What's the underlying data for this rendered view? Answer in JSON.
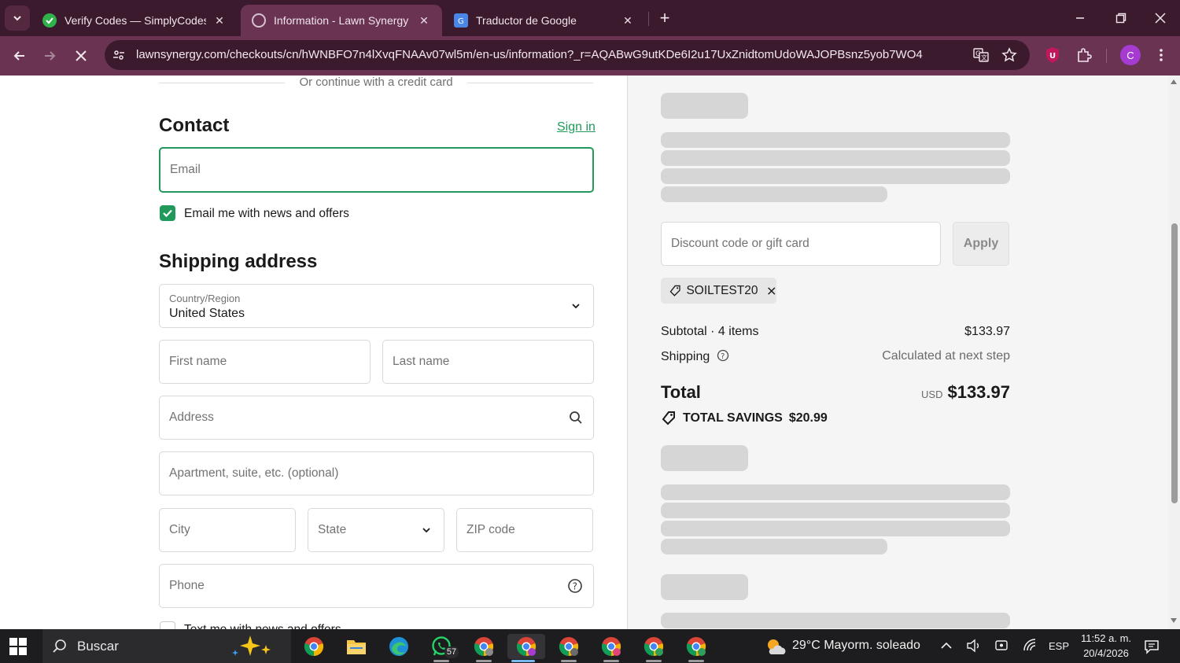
{
  "browser": {
    "tabs": [
      {
        "title": "Verify Codes — SimplyCodes",
        "active": false
      },
      {
        "title": "Information - Lawn Synergy - C",
        "active": true
      },
      {
        "title": "Traductor de Google",
        "active": false
      }
    ],
    "url": "lawnsynergy.com/checkouts/cn/hWNBFO7n4lXvqFNAAv07wl5m/en-us/information?_r=AQABwG9utKDe6I2u17UxZnidtomUdoWAJOPBsnz5yob7WO4",
    "profile_initial": "C",
    "extension_badge": "U"
  },
  "checkout": {
    "divider_text": "Or continue with a credit card",
    "contact_heading": "Contact",
    "sign_in": "Sign in",
    "email_placeholder": "Email",
    "email_opt_in_label": "Email me with news and offers",
    "email_opt_in_checked": true,
    "shipping_heading": "Shipping address",
    "country_label": "Country/Region",
    "country_value": "United States",
    "first_name_placeholder": "First name",
    "last_name_placeholder": "Last name",
    "address_placeholder": "Address",
    "apartment_placeholder": "Apartment, suite, etc. (optional)",
    "city_placeholder": "City",
    "state_placeholder": "State",
    "zip_placeholder": "ZIP code",
    "phone_placeholder": "Phone",
    "text_opt_in_label": "Text me with news and offers"
  },
  "summary": {
    "discount_placeholder": "Discount code or gift card",
    "apply_label": "Apply",
    "discount_tag": "SOILTEST20",
    "subtotal_label": "Subtotal · 4 items",
    "subtotal_value": "$133.97",
    "shipping_label": "Shipping",
    "shipping_value": "Calculated at next step",
    "total_label": "Total",
    "currency": "USD",
    "total_value": "$133.97",
    "savings_label": "TOTAL SAVINGS",
    "savings_value": "$20.99"
  },
  "taskbar": {
    "search_label": "Buscar",
    "whatsapp_badge": "57",
    "weather": "29°C  Mayorm. soleado",
    "language": "ESP",
    "time": "11:52 a. m.",
    "date": "20/4/2026"
  },
  "colors": {
    "accent": "#1f9a5a",
    "chrome_dark": "#3c1a2e",
    "chrome_toolbar": "#6b3352"
  }
}
